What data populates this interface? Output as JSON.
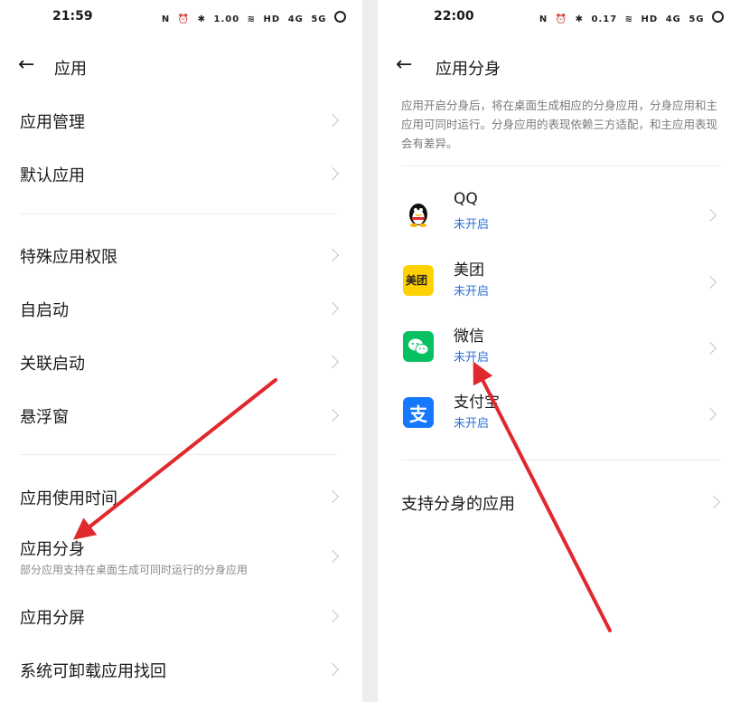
{
  "status_icons": {
    "nfc": "N",
    "alarm": "⏰",
    "bluetooth": "✱",
    "speed_right": "0.17",
    "speed_left": "1.00",
    "hd": "HD",
    "signal1": "4G",
    "signal2": "5G"
  },
  "left": {
    "time": "21:59",
    "title": "应用",
    "items": [
      {
        "label": "应用管理"
      },
      {
        "label": "默认应用"
      },
      {
        "label": "特殊应用权限"
      },
      {
        "label": "自启动"
      },
      {
        "label": "关联启动"
      },
      {
        "label": "悬浮窗"
      },
      {
        "label": "应用使用时间"
      },
      {
        "label": "应用分身",
        "sub": "部分应用支持在桌面生成可同时运行的分身应用"
      },
      {
        "label": "应用分屏"
      },
      {
        "label": "系统可卸载应用找回"
      }
    ]
  },
  "right": {
    "time": "22:00",
    "title": "应用分身",
    "description": "应用开启分身后，将在桌面生成相应的分身应用，分身应用和主应用可同时运行。分身应用的表现依赖三方适配，和主应用表现会有差异。",
    "apps": [
      {
        "name": "QQ",
        "status": "未开启",
        "icon": "qq-penguin-icon"
      },
      {
        "name": "美团",
        "status": "未开启",
        "icon": "meituan-icon",
        "icon_text": "美团"
      },
      {
        "name": "微信",
        "status": "未开启",
        "icon": "wechat-icon"
      },
      {
        "name": "支付宝",
        "status": "未开启",
        "icon": "alipay-icon",
        "icon_text": "支"
      }
    ],
    "supported_label": "支持分身的应用"
  },
  "colors": {
    "accent_blue": "#2c6fd6",
    "arrow_red": "#e0282e",
    "meituan_yellow": "#ffd100",
    "wechat_green": "#07c160",
    "alipay_blue": "#1677ff"
  }
}
